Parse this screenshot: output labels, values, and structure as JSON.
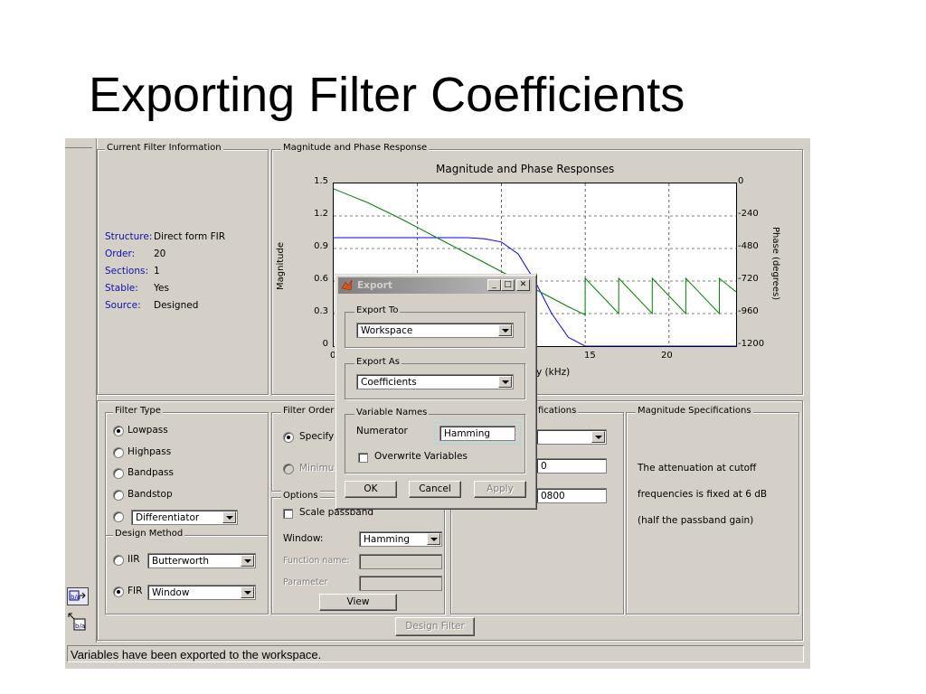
{
  "slide": {
    "title": "Exporting Filter Coefficients"
  },
  "current_info": {
    "panel_title": "Current Filter Information",
    "rows": [
      {
        "label": "Structure:",
        "value": "Direct form FIR"
      },
      {
        "label": "Order:",
        "value": "20"
      },
      {
        "label": "Sections:",
        "value": "1"
      },
      {
        "label": "Stable:",
        "value": "Yes"
      },
      {
        "label": "Source:",
        "value": "Designed"
      }
    ]
  },
  "response": {
    "panel_title": "Magnitude and Phase Response",
    "plot_title": "Magnitude and Phase  Responses",
    "ylabel_left": "Magnitude",
    "ylabel_right": "Phase (degrees)",
    "xlabel_partial": "y (kHz)",
    "yticks_left": [
      "1.5",
      "1.2",
      "0.9",
      "0.6",
      "0.3",
      "0"
    ],
    "yticks_right": [
      "0",
      "-240",
      "-480",
      "-720",
      "-960",
      "-1200"
    ],
    "xticks": [
      "0",
      "15",
      "20"
    ]
  },
  "chart_data": {
    "type": "line",
    "title": "Magnitude and Phase  Responses",
    "ylabel": "Magnitude",
    "ylabel_right": "Phase (degrees)",
    "ylim": [
      0,
      1.5
    ],
    "ylim_right": [
      -1200,
      0
    ],
    "xlim": [
      0,
      24
    ],
    "grid": true,
    "series": [
      {
        "x": [
          0,
          5,
          8,
          9,
          10,
          11,
          12,
          13,
          14,
          15,
          24
        ],
        "values": [
          1.0,
          1.0,
          1.0,
          0.99,
          0.96,
          0.85,
          0.6,
          0.3,
          0.08,
          0.0,
          0.0
        ]
      },
      {
        "x": [
          0,
          2,
          4,
          6,
          8,
          10,
          12,
          14,
          15,
          15,
          17,
          17,
          19,
          19,
          21,
          21,
          23,
          23,
          24
        ],
        "values": [
          -40,
          -140,
          -260,
          -390,
          -520,
          -650,
          -780,
          -910,
          -970,
          -700,
          -960,
          -700,
          -960,
          -700,
          -960,
          -700,
          -960,
          -700,
          -800
        ]
      }
    ]
  },
  "filter_type": {
    "panel_title": "Filter Type",
    "options": [
      "Lowpass",
      "Highpass",
      "Bandpass",
      "Bandstop"
    ],
    "selected": "Lowpass",
    "other_select": "Differentiator"
  },
  "design_method": {
    "title": "Design Method",
    "iir_label": "IIR",
    "iir_value": "Butterworth",
    "fir_label": "FIR",
    "fir_value": "Window"
  },
  "filter_order": {
    "panel_title": "Filter Order",
    "specify_label": "Specify",
    "minimum_label": "Minimum"
  },
  "options": {
    "title": "Options",
    "scale_label": "Scale passband",
    "window_label": "Window:",
    "window_value": "Hamming",
    "function_label": "Function name:",
    "parameter_label": "Parameter",
    "view_button": "View"
  },
  "freq_specs": {
    "title_partial": "fications",
    "value1": "0",
    "value2": "0800"
  },
  "mag_specs": {
    "title": "Magnitude Specifications",
    "text_lines": [
      "The attenuation at cutoff",
      "frequencies is fixed at 6 dB",
      "(half the passband gain)"
    ]
  },
  "design_button": "Design Filter",
  "status": "Variables have been exported to the workspace.",
  "export_dialog": {
    "title": "Export",
    "export_to_label": "Export To",
    "export_to_value": "Workspace",
    "export_as_label": "Export As",
    "export_as_value": "Coefficients",
    "var_names_label": "Variable Names",
    "numerator_label": "Numerator",
    "numerator_value": "Hamming",
    "overwrite_label": "Overwrite Variables",
    "ok": "OK",
    "cancel": "Cancel",
    "apply": "Apply"
  }
}
